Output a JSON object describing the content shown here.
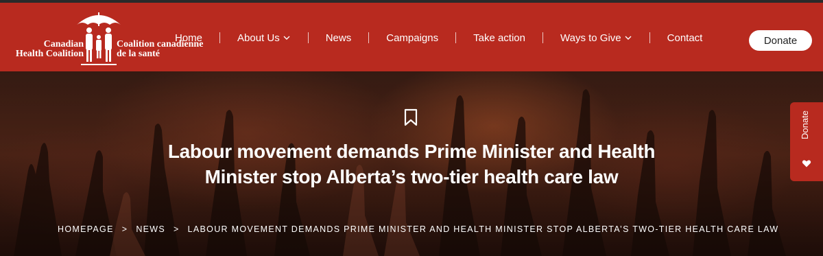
{
  "logo": {
    "left_line1": "Canadian",
    "left_line2": "Health Coalition",
    "right_line1": "Coalition canadienne",
    "right_line2": "de la santé",
    "icon": "umbrella-family-icon"
  },
  "nav": {
    "items": [
      {
        "label": "Home"
      },
      {
        "label": "About Us",
        "icon": "chevron-down-icon"
      },
      {
        "label": "News"
      },
      {
        "label": "Campaigns"
      },
      {
        "label": "Take action"
      },
      {
        "label": "Ways to Give",
        "icon": "chevron-down-icon"
      },
      {
        "label": "Contact"
      }
    ],
    "donate_label": "Donate"
  },
  "hero": {
    "bookmark_icon": "bookmark-icon",
    "title": "Labour movement demands Prime Minister and Health Minister stop Alberta’s two-tier health care law",
    "breadcrumb": [
      "HOMEPAGE",
      "NEWS",
      "LABOUR MOVEMENT DEMANDS PRIME MINISTER AND HEALTH MINISTER STOP ALBERTA’S TWO-TIER HEALTH CARE LAW"
    ],
    "breadcrumb_separator": ">"
  },
  "side_donate": {
    "label": "Donate",
    "icon": "heart-icon"
  },
  "colors": {
    "brand_red": "#b82a1f",
    "white": "#ffffff"
  }
}
